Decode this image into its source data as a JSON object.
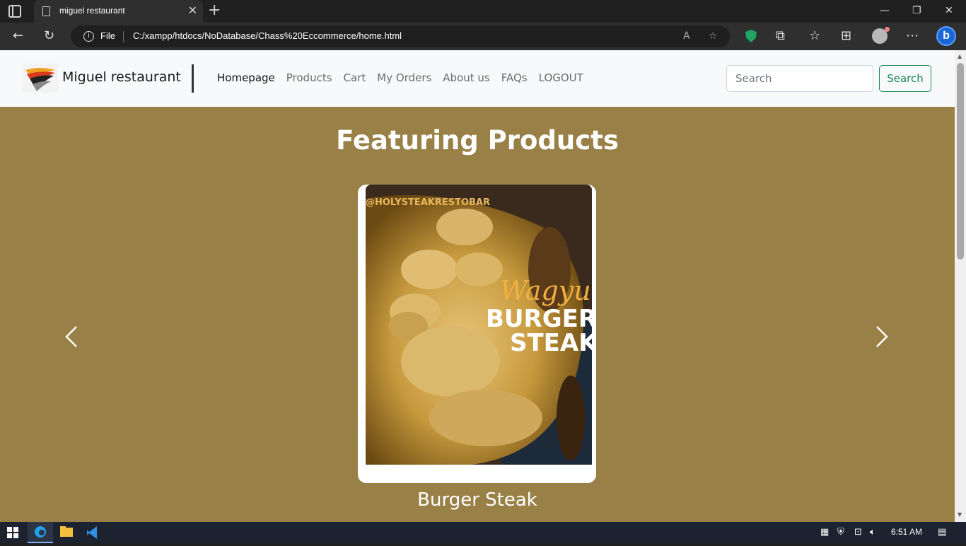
{
  "browser": {
    "tab_title": "miguel restaurant",
    "address_label": "File",
    "url": "C:/xampp/htdocs/NoDatabase/Chass%20Eccommerce/home.html"
  },
  "site": {
    "brand": "Miguel restaurant",
    "nav": [
      {
        "label": "Homepage",
        "active": true
      },
      {
        "label": "Products"
      },
      {
        "label": "Cart"
      },
      {
        "label": "My Orders"
      },
      {
        "label": "About us"
      },
      {
        "label": "FAQs"
      },
      {
        "label": "LOGOUT"
      }
    ],
    "search": {
      "placeholder": "Search",
      "button_label": "Search"
    },
    "section_title": "Featuring Products",
    "carousel": {
      "current_product": "Burger Steak",
      "image": {
        "watermark": "@HOLYSTEAKRESTOBAR",
        "script_text": "Wagyu",
        "line1": "BURGER",
        "line2": "STEAK"
      }
    }
  },
  "colors": {
    "page_background": "#998046",
    "navbar_background": "#f8f9fa",
    "search_button": "#198754"
  },
  "taskbar": {
    "clock": "6:51 AM"
  }
}
